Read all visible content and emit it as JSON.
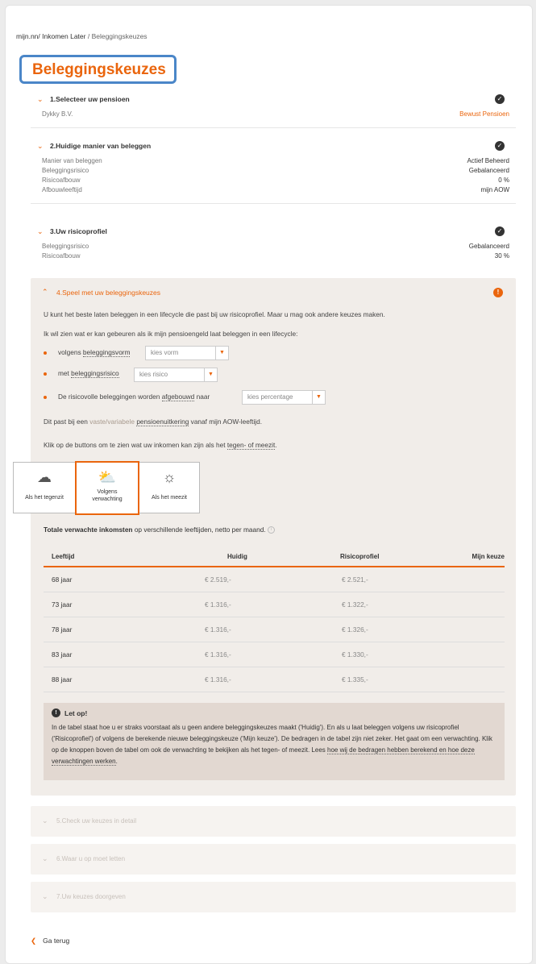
{
  "breadcrumb": {
    "root": "mijn.nn/",
    "part1": " Inkomen Later",
    "sep": " / ",
    "part2": "Beleggingskeuzes"
  },
  "page_title": "Beleggingskeuzes",
  "section1": {
    "title": "1.Selecteer uw pensioen",
    "company": "Dykky B.V.",
    "pension": "Bewust Pensioen"
  },
  "section2": {
    "title": "2.Huidige manier van beleggen",
    "rows": [
      {
        "k": "Manier van beleggen",
        "v": "Actief Beheerd"
      },
      {
        "k": "Beleggingsrisico",
        "v": "Gebalanceerd"
      },
      {
        "k": "Risicoafbouw",
        "v": "0 %"
      },
      {
        "k": "Afbouwleeftijd",
        "v": "mijn AOW"
      }
    ]
  },
  "section3": {
    "title": "3.Uw risicoprofiel",
    "rows": [
      {
        "k": "Beleggingsrisico",
        "v": "Gebalanceerd"
      },
      {
        "k": "Risicoafbouw",
        "v": "30 %"
      }
    ]
  },
  "section4": {
    "title": "4.Speel met uw beleggingskeuzes",
    "intro": "U kunt het beste laten beleggen in een lifecycle die past bij uw risicoprofiel. Maar u mag ook andere keuzes maken.",
    "wish": "Ik wil zien wat er kan gebeuren als ik mijn pensioengeld laat beleggen in een lifecycle:",
    "b1_pre": "volgens ",
    "b1_link": "beleggingsvorm",
    "b1_select": "kies vorm",
    "b2_pre": "met ",
    "b2_link": "beleggingsrisico",
    "b2_select": "kies risico",
    "b3_pre": "De risicovolle beleggingen worden ",
    "b3_link": "afgebouwd",
    "b3_post": " naar",
    "b3_select": "kies percentage",
    "fit_pre": "Dit past bij een ",
    "fit_light": "vaste/variabele",
    "fit_space": " ",
    "fit_link": "pensioenuitkering",
    "fit_post": " vanaf mijn AOW-leeftijd.",
    "click_pre": "Klik op de buttons om te zien wat uw inkomen kan zijn als het ",
    "click_link": "tegen- of meezit",
    "click_post": ".",
    "scenarios": [
      {
        "label": "Als het tegenzit",
        "icon": "storm-icon"
      },
      {
        "label1": "Volgens",
        "label2": "verwachting",
        "icon": "partly-cloudy-icon"
      },
      {
        "label": "Als het meezit",
        "icon": "sun-icon"
      }
    ],
    "table_caption_bold": "Totale verwachte inkomsten",
    "table_caption_rest": " op verschillende leeftijden, netto per maand.",
    "table": {
      "headers": [
        "Leeftijd",
        "Huidig",
        "Risicoprofiel",
        "Mijn keuze"
      ],
      "rows": [
        [
          "68 jaar",
          "€ 2.519,-",
          "€ 2.521,-",
          ""
        ],
        [
          "73 jaar",
          "€ 1.316,-",
          "€ 1.322,-",
          ""
        ],
        [
          "78 jaar",
          "€ 1.316,-",
          "€ 1.326,-",
          ""
        ],
        [
          "83 jaar",
          "€ 1.316,-",
          "€ 1.330,-",
          ""
        ],
        [
          "88 jaar",
          "€ 1.316,-",
          "€ 1.335,-",
          ""
        ]
      ]
    },
    "note_title": "Let op!",
    "note_body": "In de tabel staat hoe u er straks voorstaat als u geen andere beleggingskeuzes maakt ('Huidig'). En als u laat beleggen volgens uw risicoprofiel ('Risicoprofiel') of volgens de berekende nieuwe beleggingskeuze ('Mijn keuze'). De bedragen in de tabel zijn niet zeker. Het gaat om een verwachting. Klik op de knoppen boven de tabel om ook de verwachting te bekijken als het tegen- of meezit. Lees ",
    "note_link": "hoe wij de bedragen hebben berekend en hoe deze verwachtingen werken",
    "note_end": "."
  },
  "section5": {
    "title": "5.Check uw keuzes in detail"
  },
  "section6": {
    "title": "6.Waar u op moet letten"
  },
  "section7": {
    "title": "7.Uw keuzes doorgeven"
  },
  "back": {
    "label": "Ga terug"
  },
  "colors": {
    "accent": "#ea650d",
    "panel": "#f1ede9",
    "highlight_box": "#4a86c8"
  }
}
